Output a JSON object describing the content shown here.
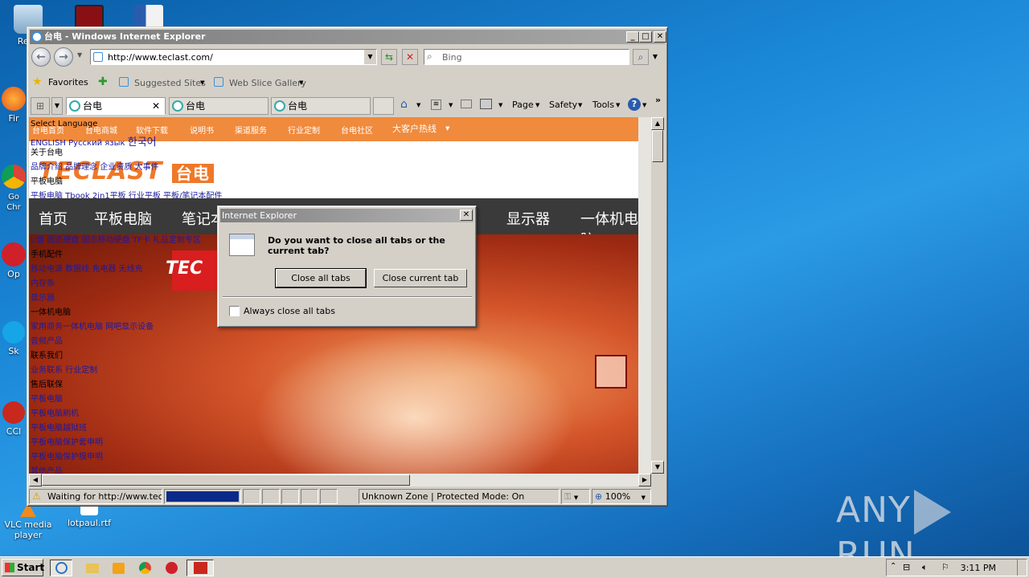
{
  "desktop": {
    "icons": [
      {
        "label": "Recy"
      },
      {
        "label": "Fir"
      },
      {
        "label": "Go\nChr"
      },
      {
        "label": "Op"
      },
      {
        "label": "Sk"
      },
      {
        "label": "CCl"
      },
      {
        "label": "VLC media\nplayer"
      },
      {
        "label": "lotpaul.rtf"
      }
    ],
    "watermark": {
      "left": "ANY",
      "right": "RUN"
    }
  },
  "window": {
    "title": "台电 - Windows Internet Explorer",
    "address": "http://www.teclast.com/",
    "search_placeholder": "Bing",
    "favorites": {
      "favorites_label": "Favorites",
      "suggested_sites": "Suggested Sites",
      "web_slice_gallery": "Web Slice Gallery"
    },
    "tabs": [
      {
        "label": "台电"
      },
      {
        "label": "台电"
      },
      {
        "label": "台电"
      }
    ],
    "command_bar": {
      "page": "Page",
      "safety": "Safety",
      "tools": "Tools"
    },
    "status": {
      "text": "Waiting for http://www.teclas",
      "zone": "Unknown Zone | Protected Mode: On",
      "zoom": "100%",
      "progress": 1.0
    }
  },
  "page": {
    "select_language": "Select Language",
    "orange_links": [
      "台电首页",
      "台电商城",
      "软件下载",
      "说明书",
      "渠道服务",
      "行业定制",
      "台电社区",
      "大客户热线"
    ],
    "lang_line": "ENGLISH Русский язык",
    "lang_korean": "한국어",
    "logo_text": "TECLAST",
    "logo_cn": "台电",
    "left_links": [
      "关于台电",
      "品牌介绍 品牌理念 企业资质 大事件",
      "平板电脑",
      "平板电脑 Tbook 2in1平板 行业平板 平板/笔记本配件"
    ],
    "nav": [
      "首页",
      "平板电脑",
      "笔记本",
      "显示器",
      "一体机电脑"
    ],
    "left_links2": [
      "U盘 固态硬盘 固态移动硬盘 TF卡 礼品定制专区",
      "手机配件",
      "移动电源 数据线 充电器 无线充",
      "内存条",
      "显示器",
      "一体机电脑",
      "家用商务一体机电脑 网吧显示设备",
      "音频产品",
      "联系我们",
      "业务联系 行业定制",
      "售后联保",
      "平板电脑",
      "平板电脑刷机",
      "平板电脑越狱班",
      "平板电脑保护套申明",
      "平板电脑保护膜申明",
      "其他产品"
    ],
    "banner_brand": "TEC"
  },
  "dialog": {
    "title": "Internet Explorer",
    "message": "Do you want to close all tabs or the current tab?",
    "close_all": "Close all tabs",
    "close_current": "Close current tab",
    "checkbox_label": "Always close all tabs",
    "checkbox_checked": false
  },
  "taskbar": {
    "start": "Start",
    "clock": "3:11 PM"
  }
}
